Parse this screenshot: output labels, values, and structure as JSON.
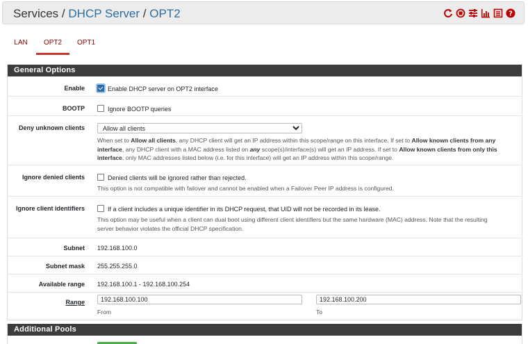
{
  "breadcrumb": {
    "root": "Services",
    "sep": "/",
    "section": "DHCP Server",
    "page": "OPT2"
  },
  "header_icons": [
    "reload-icon",
    "stop-icon",
    "sliders-icon",
    "chart-icon",
    "log-icon",
    "help-icon"
  ],
  "tabs": [
    {
      "label": "LAN",
      "active": false
    },
    {
      "label": "OPT2",
      "active": true
    },
    {
      "label": "OPT1",
      "active": false
    }
  ],
  "general": {
    "title": "General Options",
    "enable": {
      "label": "Enable",
      "text": "Enable DHCP server on OPT2 interface",
      "checked": true
    },
    "bootp": {
      "label": "BOOTP",
      "text": "Ignore BOOTP queries",
      "checked": false
    },
    "deny": {
      "label": "Deny unknown clients",
      "selected": "Allow all clients",
      "help_1": "When set to ",
      "help_b1": "Allow all clients",
      "help_2": ", any DHCP client will get an IP address within this scope/range on this interface. If set to ",
      "help_b2": "Allow known clients from any interface",
      "help_3": ", any DHCP client with a MAC address listed on ",
      "help_i": "any",
      "help_4": " scope(s)/interface(s) will get an IP address. If set to ",
      "help_b3": "Allow known clients from only this interface",
      "help_5": ", only MAC addresses listed below (i.e. for this interface) will get an IP address within this scope/range."
    },
    "denied": {
      "label": "Ignore denied clients",
      "text": "Denied clients will be ignored rather than rejected.",
      "help": "This option is not compatible with failover and cannot be enabled when a Failover Peer IP address is configured."
    },
    "identifiers": {
      "label": "Ignore client identifiers",
      "text": "If a client includes a unique identifier in its DHCP request, that UID will not be recorded in its lease.",
      "help_1": "This option may be useful when a client can dual boot using different client identifiers but the same hardware (MAC) address. Note that the resulting",
      "help_2": "server behavior violates the official DHCP specification."
    },
    "subnet": {
      "label": "Subnet",
      "value": "192.168.100.0"
    },
    "mask": {
      "label": "Subnet mask",
      "value": "255.255.255.0"
    },
    "available": {
      "label": "Available range",
      "value": "192.168.100.1 - 192.168.100.254"
    },
    "range": {
      "label": "Range",
      "from_value": "192.168.100.100",
      "from_label": "From",
      "to_value": "192.168.100.200",
      "to_label": "To"
    }
  },
  "additional": {
    "title": "Additional Pools"
  },
  "colors": {
    "accent": "#c0392b",
    "link": "#2d6ca2",
    "panel_head": "#3c3c3c",
    "button_green": "#4cae4c"
  }
}
